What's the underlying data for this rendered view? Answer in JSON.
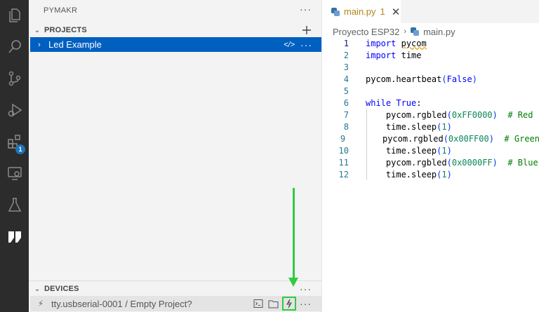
{
  "sidebar": {
    "title": "PYMAKR",
    "projects_section": "PROJECTS",
    "project": {
      "name": "Led Example",
      "code_icon": "</>"
    },
    "devices_section": "DEVICES",
    "device": {
      "name": "tty.usbserial-0001 / Empty Project?"
    }
  },
  "activity_bar": {
    "icons": [
      "files-icon",
      "search-icon",
      "source-control-icon",
      "run-debug-icon",
      "extensions-icon",
      "remote-explorer-icon",
      "testing-icon",
      "pymakr-icon"
    ],
    "extensions_badge": "1"
  },
  "editor": {
    "tab": {
      "name": "main.py",
      "problems": "1"
    },
    "breadcrumb": {
      "folder": "Proyecto ESP32",
      "file": "main.py"
    },
    "line_numbers": [
      "1",
      "2",
      "3",
      "4",
      "5",
      "6",
      "7",
      "8",
      "9",
      "10",
      "11",
      "12"
    ],
    "code": {
      "l1_kw": "import",
      "l1_mod": "pycom",
      "l2_kw": "import",
      "l2_mod": "time",
      "l4_a": "pycom.heartbeat",
      "l4_p1": "(",
      "l4_arg": "False",
      "l4_p2": ")",
      "l6_kw": "while",
      "l6_val": "True",
      "l6_colon": ":",
      "l7_fn": "pycom.rgbled",
      "l7_hex": "0x",
      "l7_val": "FF0000",
      "l7_cm": "# Red",
      "l8_fn": "time.sleep",
      "l8_arg": "1",
      "l9_fn": "pycom.rgbled",
      "l9_hex": "0x",
      "l9_val": "00FF00",
      "l9_cm": "# Green",
      "l10_fn": "time.sleep",
      "l10_arg": "1",
      "l11_fn": "pycom.rgbled",
      "l11_hex": "0x",
      "l11_val": "0000FF",
      "l11_cm": "# Blue",
      "l12_fn": "time.sleep",
      "l12_arg": "1"
    }
  },
  "colors": {
    "selection": "#0060c0",
    "annotation": "#2ecc40",
    "activity_bar": "#2c2c2c"
  }
}
